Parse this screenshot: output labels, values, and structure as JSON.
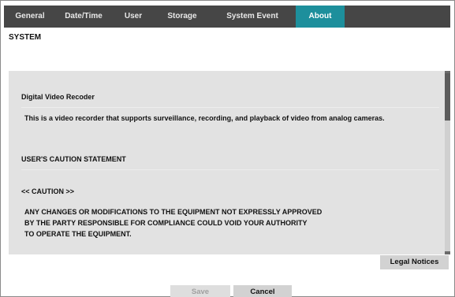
{
  "tabs": [
    {
      "label": "General",
      "active": false
    },
    {
      "label": "Date/Time",
      "active": false
    },
    {
      "label": "User",
      "active": false
    },
    {
      "label": "Storage",
      "active": false
    },
    {
      "label": "System Event",
      "active": false
    },
    {
      "label": "About",
      "active": true
    }
  ],
  "section_title": "SYSTEM",
  "content": {
    "product_heading": "Digital Video Recoder",
    "product_description": "This is a video recorder that supports surveillance, recording, and playback of video from analog cameras.",
    "caution_heading": "USER'S CAUTION STATEMENT",
    "caution_label": "<< CAUTION >>",
    "caution_lines": [
      "ANY CHANGES OR MODIFICATIONS TO THE EQUIPMENT NOT EXPRESSLY APPROVED",
      "BY THE PARTY RESPONSIBLE FOR COMPLIANCE COULD VOID YOUR AUTHORITY",
      "TO OPERATE THE EQUIPMENT."
    ]
  },
  "buttons": {
    "legal_notices": "Legal Notices",
    "save": "Save",
    "cancel": "Cancel"
  },
  "colors": {
    "tab_bar": "#464646",
    "tab_active": "#1d8f9c",
    "panel_bg": "#e2e2e2"
  }
}
